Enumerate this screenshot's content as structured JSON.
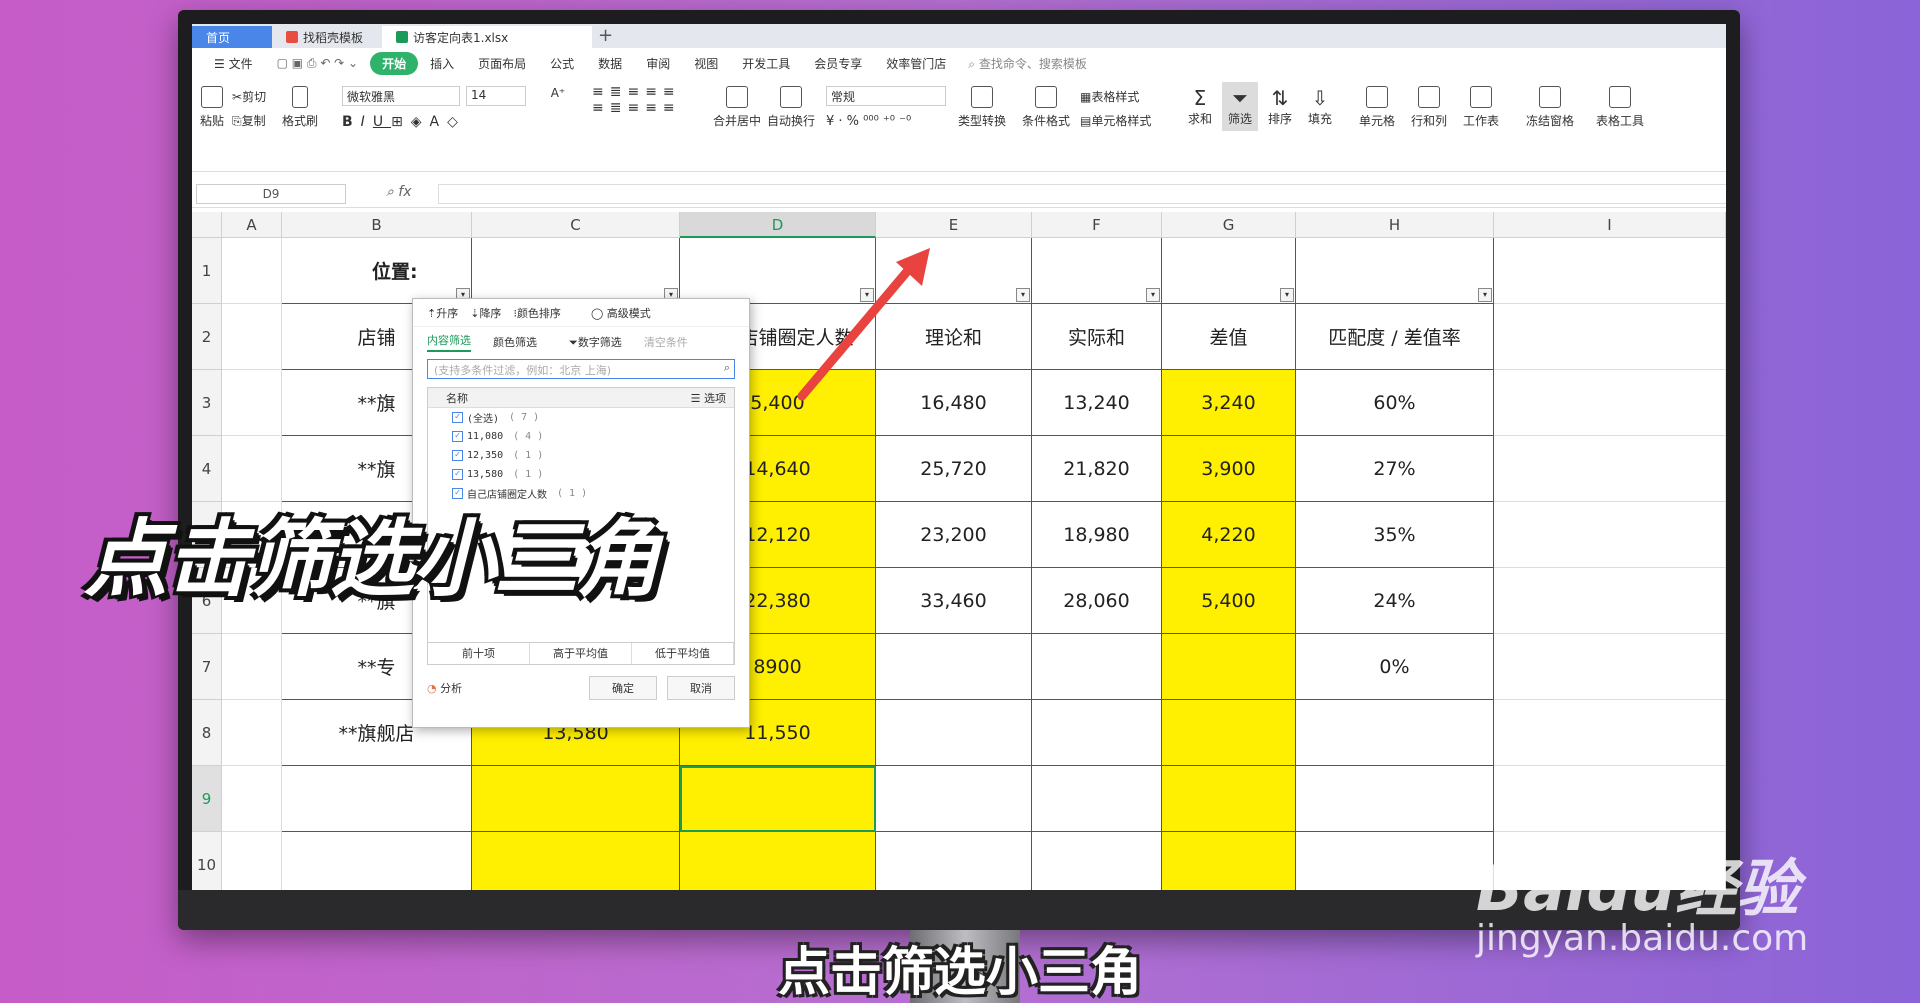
{
  "tabs": {
    "home": "首页",
    "template": "找稻壳模板",
    "file": "访客定向表1.xlsx",
    "new": "+"
  },
  "menu": {
    "file": "文件",
    "start": "开始",
    "items": [
      "插入",
      "页面布局",
      "公式",
      "数据",
      "审阅",
      "视图",
      "开发工具",
      "会员专享",
      "效率管门店"
    ],
    "search": "查找命令、搜索模板"
  },
  "ribbon": {
    "paste": "粘贴",
    "cut": "剪切",
    "copy": "复制",
    "format_painter": "格式刷",
    "font_name": "微软雅黑",
    "font_size": "14",
    "merge": "合并居中",
    "wrap": "自动换行",
    "number_format": "常规",
    "convert": "类型转换",
    "cond_format": "条件格式",
    "table_style": "表格样式",
    "cell_style": "单元格样式",
    "sum": "求和",
    "filter": "筛选",
    "sort": "排序",
    "fill": "填充",
    "cell": "单元格",
    "rowcol": "行和列",
    "sheet": "工作表",
    "freeze": "冻结窗格",
    "tools": "表格工具"
  },
  "formula_bar": {
    "cell_ref": "D9",
    "fx": "fx",
    "value": ""
  },
  "columns": [
    "A",
    "B",
    "C",
    "D",
    "E",
    "F",
    "G",
    "H",
    "I"
  ],
  "rows": [
    "1",
    "2",
    "3",
    "4",
    "5",
    "6",
    "7",
    "8",
    "9",
    "10"
  ],
  "sheet": {
    "b1": "位置:",
    "headers": {
      "b": "店铺",
      "d": "目标店铺圈定人数",
      "e": "理论和",
      "f": "实际和",
      "g": "差值",
      "h": "匹配度 / 差值率"
    },
    "b_labels": [
      "**旗",
      "**旗",
      "",
      "**旗",
      "**专",
      "**旗舰店"
    ],
    "c8": "13,580",
    "d": [
      "5,400",
      "14,640",
      "12,120",
      "22,380",
      "8900",
      "11,550"
    ],
    "e": [
      "16,480",
      "25,720",
      "23,200",
      "33,460",
      "",
      ""
    ],
    "f": [
      "13,240",
      "21,820",
      "18,980",
      "28,060",
      "",
      ""
    ],
    "g": [
      "3,240",
      "3,900",
      "4,220",
      "5,400",
      "",
      ""
    ],
    "h": [
      "60%",
      "27%",
      "35%",
      "24%",
      "0%",
      ""
    ]
  },
  "filter_popup": {
    "asc": "升序",
    "desc": "降序",
    "color_sort": "颜色排序",
    "advanced": "高级模式",
    "tab_content": "内容筛选",
    "tab_color": "颜色筛选",
    "tab_number": "数字筛选",
    "clear": "清空条件",
    "search_placeholder": "(支持多条件过滤，例如：北京 上海)",
    "list_header": "名称",
    "options": "选项",
    "items": [
      {
        "label": "(全选)",
        "count": "( 7 )"
      },
      {
        "label": "11,080",
        "count": "( 4 )"
      },
      {
        "label": "12,350",
        "count": "( 1 )"
      },
      {
        "label": "13,580",
        "count": "( 1 )"
      },
      {
        "label": "自己店铺圈定人数",
        "count": "( 1 )"
      }
    ],
    "top10": "前十项",
    "above_avg": "高于平均值",
    "below_avg": "低于平均值",
    "analyze": "分析",
    "ok": "确定",
    "cancel": "取消"
  },
  "overlay": {
    "big_caption": "点击筛选小三角",
    "subtitle": "点击筛选小三角",
    "watermark_brand": "Baidu经验",
    "watermark_url": "jingyan.baidu.com"
  },
  "colors": {
    "accent": "#1c9a5a",
    "highlight": "#ffef00",
    "arrow": "#e8433e"
  }
}
